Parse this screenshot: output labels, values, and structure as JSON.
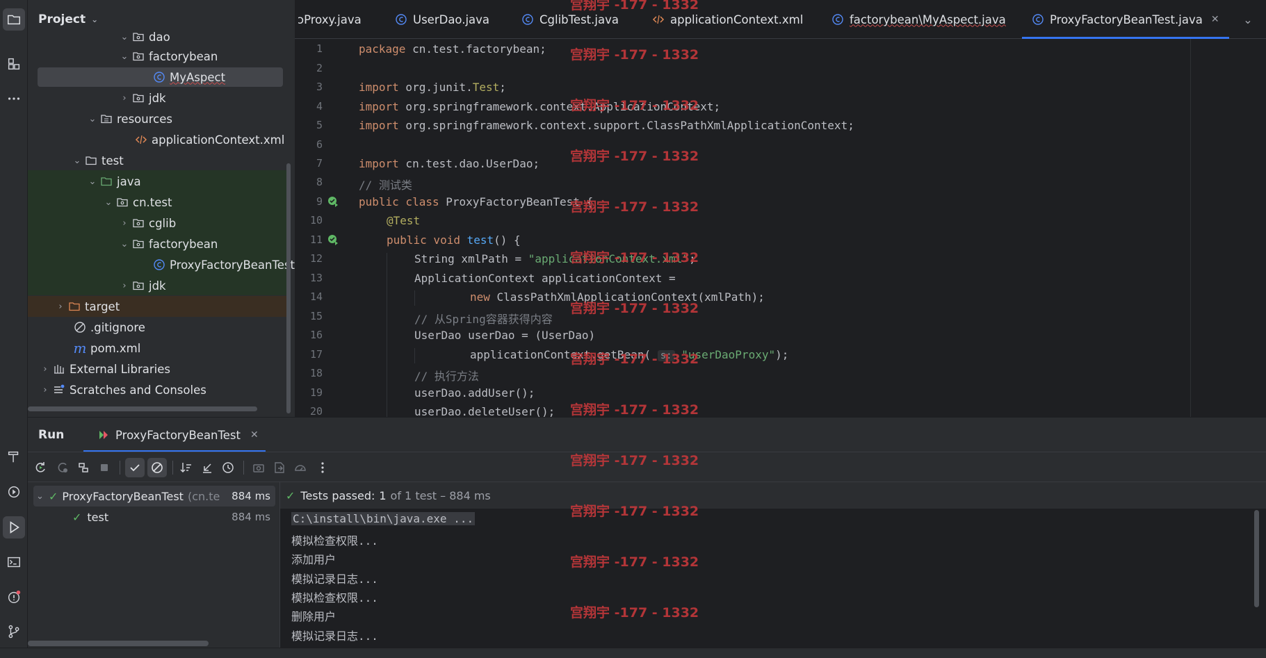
{
  "project_panel": {
    "title": "Project",
    "items": [
      {
        "label": "dao",
        "type": "package",
        "expanded": true
      },
      {
        "label": "factorybean",
        "type": "package",
        "expanded": true
      },
      {
        "label": "MyAspect",
        "type": "class",
        "selected": true
      },
      {
        "label": "jdk",
        "type": "package",
        "expanded": false
      },
      {
        "label": "resources",
        "type": "resources",
        "expanded": true
      },
      {
        "label": "applicationContext.xml",
        "type": "xml"
      },
      {
        "label": "test",
        "type": "folder",
        "expanded": true
      },
      {
        "label": "java",
        "type": "test-root",
        "expanded": true
      },
      {
        "label": "cn.test",
        "type": "package",
        "expanded": true
      },
      {
        "label": "cglib",
        "type": "package",
        "expanded": false
      },
      {
        "label": "factorybean",
        "type": "package",
        "expanded": true
      },
      {
        "label": "ProxyFactoryBeanTest",
        "type": "class"
      },
      {
        "label": "jdk",
        "type": "package",
        "expanded": false
      },
      {
        "label": "target",
        "type": "excluded",
        "expanded": false
      },
      {
        "label": ".gitignore",
        "type": "ignore"
      },
      {
        "label": "pom.xml",
        "type": "maven"
      },
      {
        "label": "External Libraries",
        "type": "library",
        "expanded": false
      },
      {
        "label": "Scratches and Consoles",
        "type": "scratch",
        "expanded": false
      }
    ]
  },
  "tabs": [
    {
      "label": "ɔProxy.java",
      "icon": "none"
    },
    {
      "label": "UserDao.java",
      "icon": "class-icon"
    },
    {
      "label": "CglibTest.java",
      "icon": "class-icon"
    },
    {
      "label": "applicationContext.xml",
      "icon": "xml-icon"
    },
    {
      "label": "factorybean\\MyAspect.java",
      "icon": "class-icon"
    },
    {
      "label": "ProxyFactoryBeanTest.java",
      "icon": "class-icon",
      "active": true
    }
  ],
  "editor": {
    "line_numbers": [
      "1",
      "2",
      "3",
      "4",
      "5",
      "6",
      "7",
      "8",
      "9",
      "10",
      "11",
      "12",
      "13",
      "14",
      "15",
      "16",
      "17",
      "18",
      "19",
      "20"
    ],
    "lines": {
      "l1a": "package",
      "l1b": " cn.test.factorybean;",
      "l3a": "import",
      "l3b": " org.junit.",
      "l3c": "Test",
      "l3d": ";",
      "l4a": "import",
      "l4b": " org.springframework.context.ApplicationContext;",
      "l5a": "import",
      "l5b": " org.springframework.context.support.ClassPathXmlApplicationContext;",
      "l7a": "import",
      "l7b": " cn.test.dao.UserDao;",
      "l8": "// 测试类",
      "l9a": "public class",
      "l9b": " ProxyFactoryBeanTest {",
      "l10": "@Test",
      "l11a": "public void",
      "l11b": "test",
      "l11c": "() {",
      "l12a": "String xmlPath = ",
      "l12b": "\"applicationContext.xml\"",
      "l12c": ";",
      "l13": "ApplicationContext applicationContext =",
      "l14a": "new",
      "l14b": " ClassPathXmlApplicationContext(xmlPath);",
      "l15": "// 从Spring容器获得内容",
      "l16": "UserDao userDao = (UserDao)",
      "l17a": "applicationContext.getBean(",
      "l17hint": "s:",
      "l17b": "\"userDaoProxy\"",
      "l17c": ");",
      "l18": "// 执行方法",
      "l19": "userDao.addUser();",
      "l20": "userDao.deleteUser();"
    }
  },
  "run_panel": {
    "title": "Run",
    "tab_label": "ProxyFactoryBeanTest",
    "status_prefix": "Tests passed:",
    "status_count": "1",
    "status_suffix": "of 1 test – 884 ms",
    "tree": [
      {
        "label": "ProxyFactoryBeanTest",
        "sub": "(cn.te",
        "time": "884 ms"
      },
      {
        "label": "test",
        "time": "884 ms"
      }
    ],
    "console_lines": [
      "C:\\install\\bin\\java.exe ...",
      "模拟检查权限...",
      "添加用户",
      "模拟记录日志...",
      "模拟检查权限...",
      "删除用户",
      "模拟记录日志..."
    ]
  },
  "watermark": "宫翔宇 -177 - 1332",
  "colors": {
    "accent": "#3574f0",
    "pass": "#5fb865",
    "watermark": "#c0373a"
  }
}
